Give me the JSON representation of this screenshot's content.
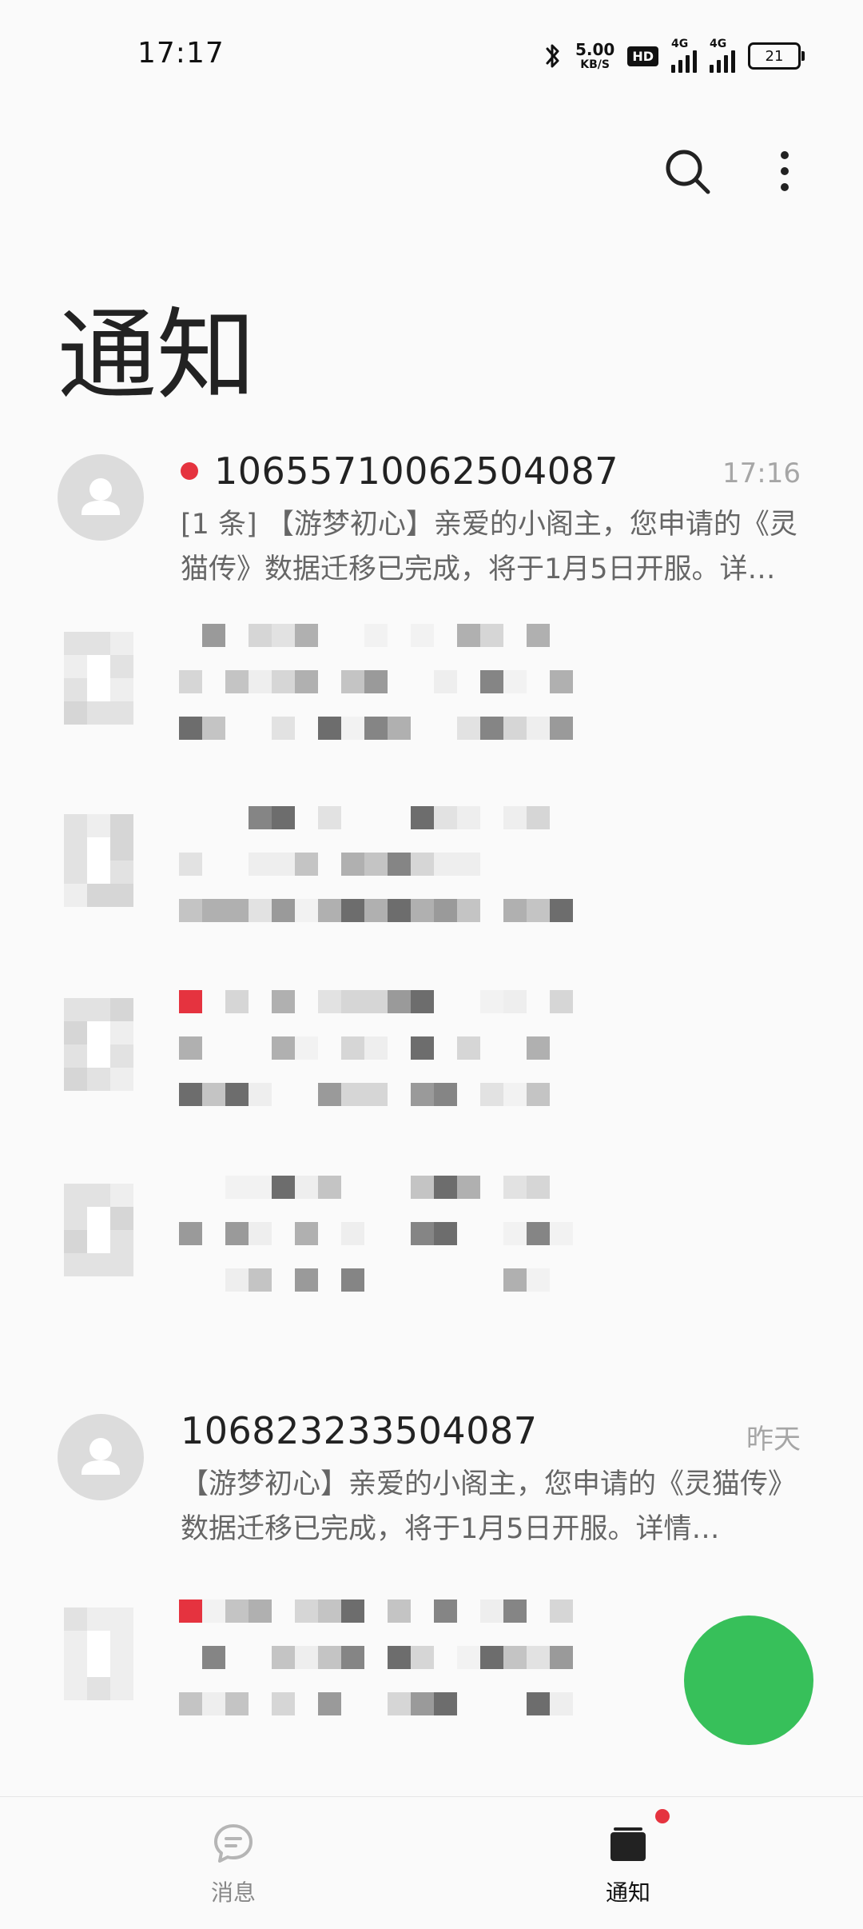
{
  "status_bar": {
    "time": "17:17",
    "speed_value": "5.00",
    "speed_unit": "KB/S",
    "hd_badge": "HD",
    "network_1": "4G",
    "network_2": "4G",
    "battery": "21"
  },
  "header": {
    "title": "通知",
    "search_icon": "search-icon",
    "more_icon": "more-vertical-icon"
  },
  "messages": [
    {
      "sender": "10655710062504087",
      "time": "17:16",
      "preview": "[1 条] 【游梦初心】亲爱的小阁主，您申请的《灵猫传》数据迁移已完成，将于1月5日开服。详…",
      "unread": true
    },
    {
      "sender": "106823233504087",
      "time": "昨天",
      "preview": "【游梦初心】亲爱的小阁主，您申请的《灵猫传》数据迁移已完成，将于1月5日开服。详情…",
      "unread": false
    }
  ],
  "bottom_nav": {
    "items": [
      {
        "label": "消息",
        "icon": "chat-bubble-icon",
        "active": false
      },
      {
        "label": "通知",
        "icon": "inbox-icon",
        "active": true
      }
    ]
  },
  "colors": {
    "accent_red": "#e5333f",
    "fab_green": "#37c05a",
    "title_text": "#222222",
    "secondary_text": "#666666",
    "time_text": "#a6a6a6"
  }
}
